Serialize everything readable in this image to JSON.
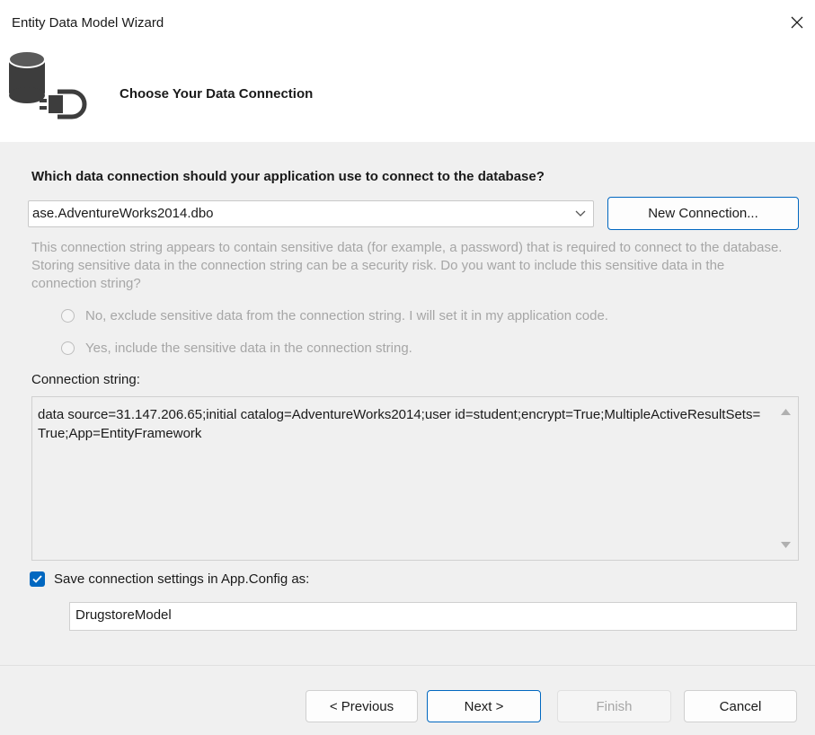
{
  "window": {
    "title": "Entity Data Model Wizard"
  },
  "header": {
    "title": "Choose Your Data Connection",
    "icon": "database-plug-icon"
  },
  "question": "Which data connection should your application use to connect to the database?",
  "connection_select": {
    "value": "ase.AdventureWorks2014.dbo"
  },
  "new_connection_label": "New Connection...",
  "sensitive_notice": "This connection string appears to contain sensitive data (for example, a password) that is required to connect to the database. Storing sensitive data in the connection string can be a security risk. Do you want to include this sensitive data in the connection string?",
  "radio_options": [
    "No, exclude sensitive data from the connection string. I will set it in my application code.",
    "Yes, include the sensitive data in the connection string."
  ],
  "connection_string_label": "Connection string:",
  "connection_string": "data source=31.147.206.65;initial catalog=AdventureWorks2014;user id=student;encrypt=True;MultipleActiveResultSets=True;App=EntityFramework",
  "save_settings": {
    "label": "Save connection settings in App.Config as:",
    "checked": true,
    "value": "DrugstoreModel"
  },
  "buttons": {
    "previous": "< Previous",
    "next": "Next >",
    "finish": "Finish",
    "cancel": "Cancel"
  },
  "colors": {
    "accent": "#0067c0",
    "disabled_text": "#a6a6a6",
    "panel": "#f0f0f0"
  }
}
